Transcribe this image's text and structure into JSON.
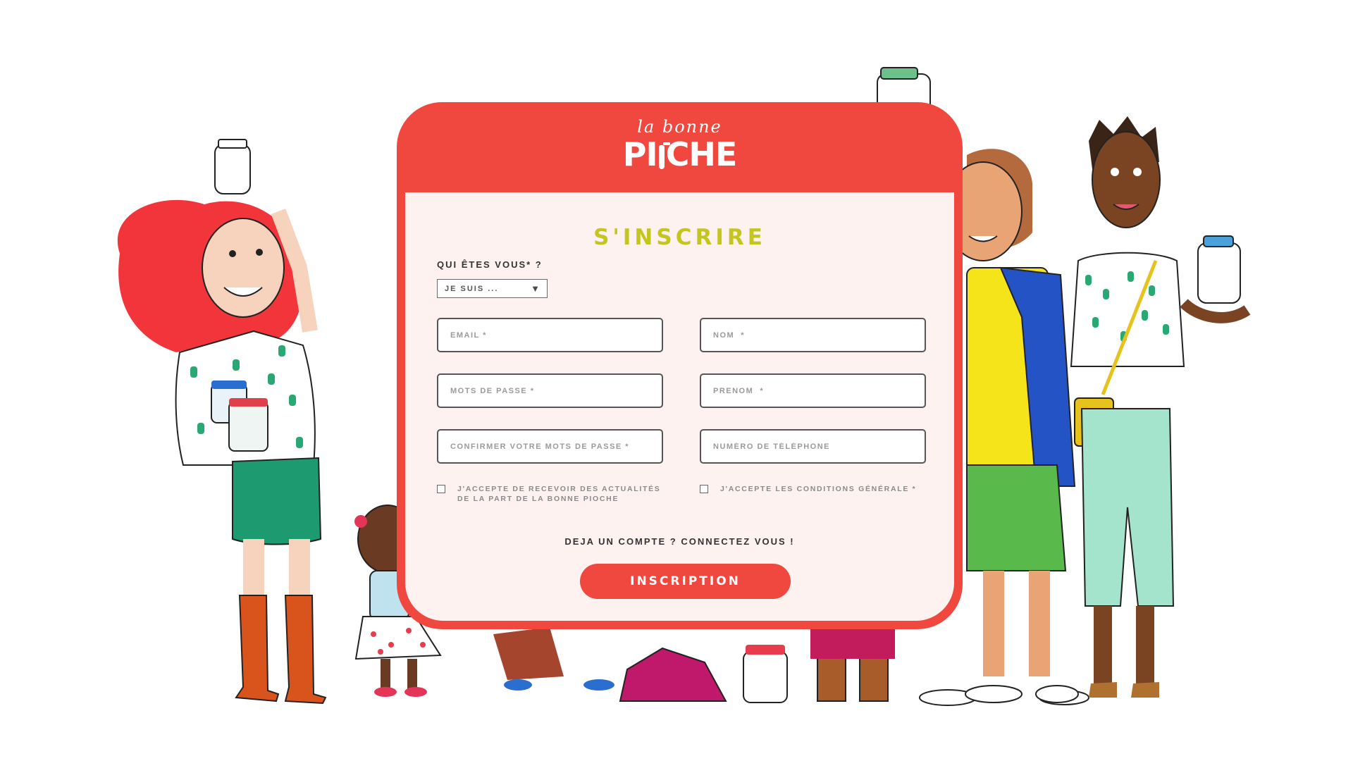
{
  "brand": {
    "script": "la bonne",
    "name_left": "PI",
    "name_right": "CHE"
  },
  "form": {
    "title": "S'INSCRIRE",
    "who_label": "QUI ÊTES VOUS* ?",
    "who_select_value": "JE SUIS ...",
    "fields": {
      "email": "EMAIL *",
      "nom": "NOM  *",
      "password": "MOTS DE PASSE *",
      "prenom": "PRENOM  *",
      "confirm_password": "CONFIRMER VOTRE MOTS DE PASSE *",
      "phone": "NUMÉRO DE TÉLÉPHONE"
    },
    "checkboxes": {
      "newsletter": "J'ACCEPTE DE RECEVOIR DES ACTUALITÉS\nDE LA PART DE LA BONNE PIOCHE",
      "terms": "J'ACCEPTE LES CONDITIONS GÉNÉRALE *"
    },
    "login_link": "DEJA UN COMPTE ? CONNECTEZ VOUS !",
    "submit_label": "INSCRIPTION"
  },
  "colors": {
    "brand_red": "#f0483e",
    "title_yellow": "#c4c51f"
  },
  "icons": {
    "select_arrow": "triangle-down",
    "logo_jar": "jar-icon"
  }
}
